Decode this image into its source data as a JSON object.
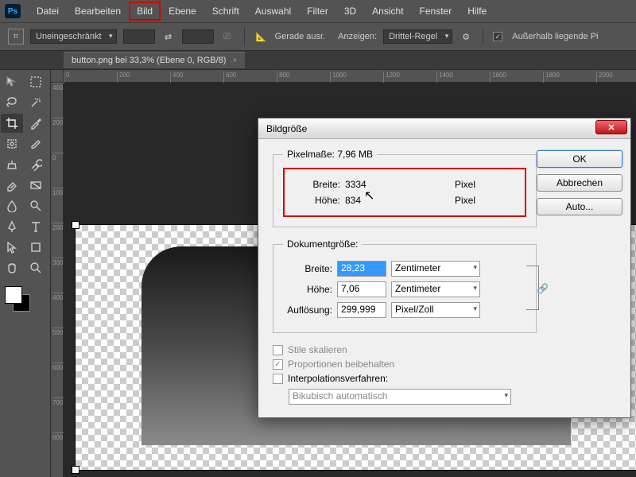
{
  "menu": {
    "items": [
      "Datei",
      "Bearbeiten",
      "Bild",
      "Ebene",
      "Schrift",
      "Auswahl",
      "Filter",
      "3D",
      "Ansicht",
      "Fenster",
      "Hilfe"
    ],
    "highlighted": 2
  },
  "options": {
    "ratio": "Uneingeschränkt",
    "straighten": "Gerade ausr.",
    "show_label": "Anzeigen:",
    "show_value": "Drittel-Regel",
    "outside": "Außerhalb liegende Pi"
  },
  "doc": {
    "tab": "button.png bei 33,3% (Ebene 0, RGB/8)"
  },
  "ruler_h": [
    "0",
    "200",
    "400",
    "600",
    "800",
    "1000",
    "1200",
    "1400",
    "1600",
    "1800",
    "2000"
  ],
  "ruler_v": [
    "400",
    "200",
    "0",
    "100",
    "200",
    "300",
    "400",
    "500",
    "600",
    "700",
    "800"
  ],
  "dialog": {
    "title": "Bildgröße",
    "pixel_legend": "Pixelmaße: 7,96 MB",
    "px_width_lbl": "Breite:",
    "px_width": "3334",
    "px_width_unit": "Pixel",
    "px_height_lbl": "Höhe:",
    "px_height": "834",
    "px_height_unit": "Pixel",
    "doc_legend": "Dokumentgröße:",
    "doc_width_lbl": "Breite:",
    "doc_width": "28,23",
    "doc_width_unit": "Zentimeter",
    "doc_height_lbl": "Höhe:",
    "doc_height": "7,06",
    "doc_height_unit": "Zentimeter",
    "res_lbl": "Auflösung:",
    "res": "299,999",
    "res_unit": "Pixel/Zoll",
    "scale_styles": "Stile skalieren",
    "constrain": "Proportionen beibehalten",
    "interp_lbl": "Interpolationsverfahren:",
    "interp_val": "Bikubisch automatisch",
    "ok": "OK",
    "cancel": "Abbrechen",
    "auto": "Auto..."
  }
}
